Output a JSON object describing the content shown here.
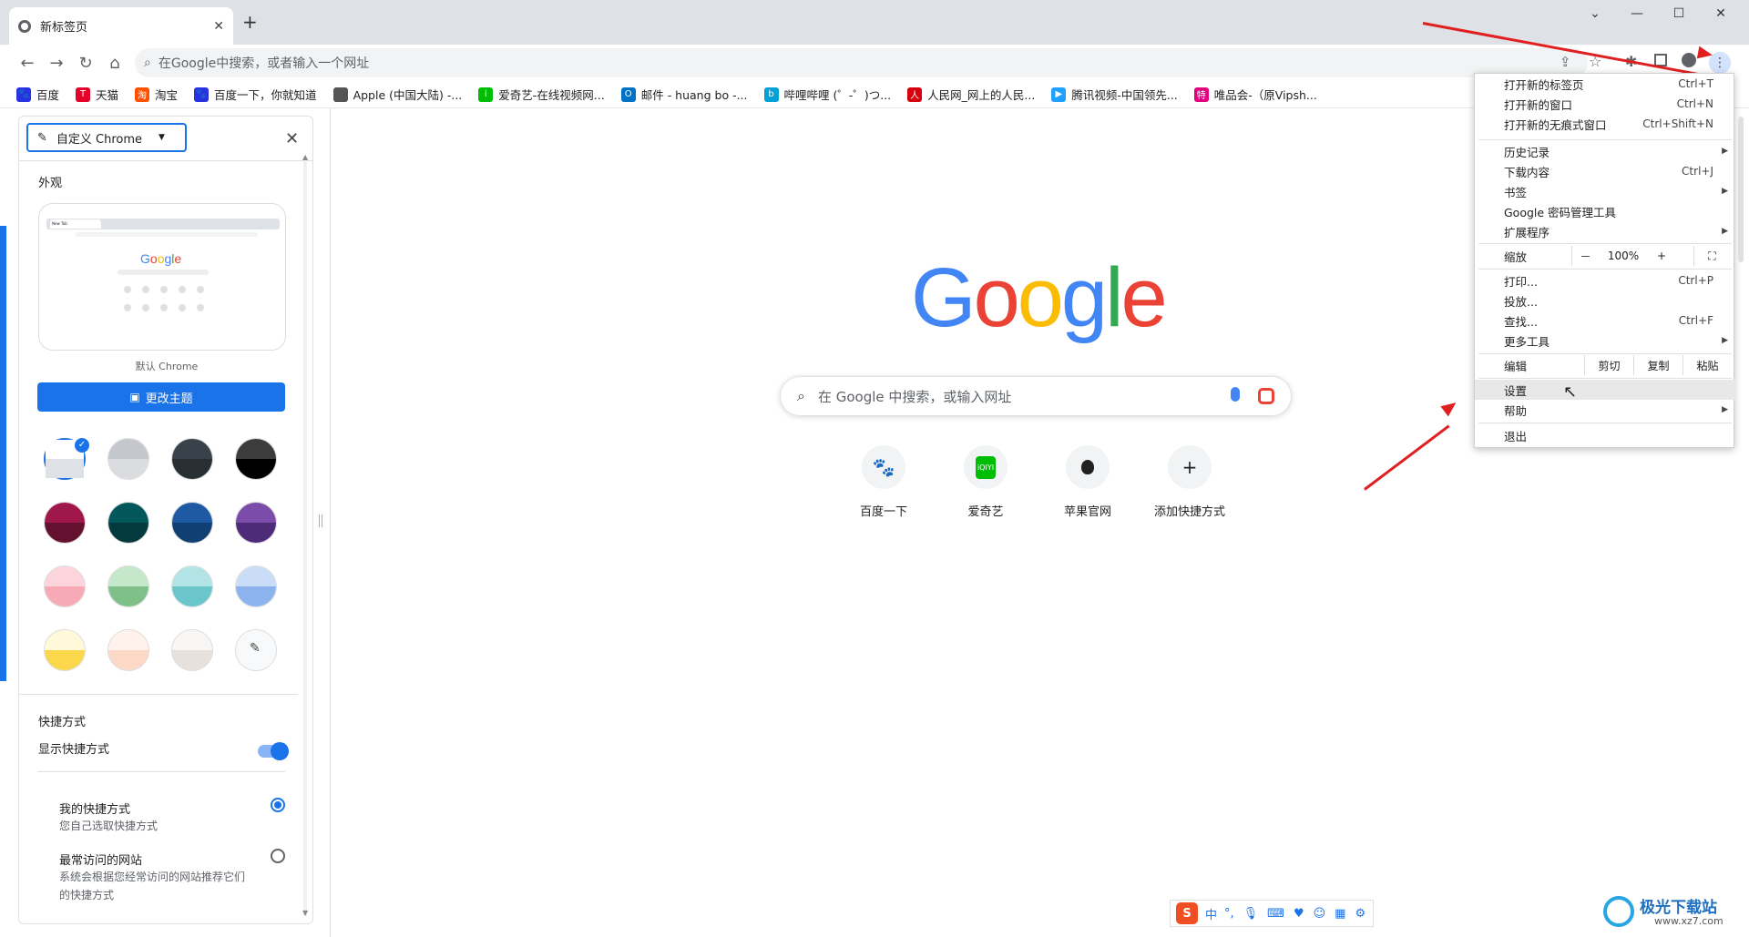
{
  "browser": {
    "tab_title": "新标签页",
    "new_tab_symbol": "+",
    "omnibox_placeholder": "在Google中搜索，或者输入一个网址",
    "window_controls": [
      "chevron-down-icon",
      "minimize-icon",
      "maximize-icon",
      "close-icon"
    ]
  },
  "bookmarks": [
    {
      "label": "百度",
      "color": "#2932e1",
      "icon": "paw-icon"
    },
    {
      "label": "天猫",
      "color": "#e4002b",
      "icon": "tmall-icon"
    },
    {
      "label": "淘宝",
      "color": "#ff5000",
      "icon": "taobao-icon"
    },
    {
      "label": "百度一下，你就知道",
      "color": "#2932e1",
      "icon": "paw-icon"
    },
    {
      "label": "Apple (中国大陆) -...",
      "color": "#555555",
      "icon": "apple-icon"
    },
    {
      "label": "爱奇艺-在线视频网...",
      "color": "#00be06",
      "icon": "iqiyi-icon"
    },
    {
      "label": "邮件 - huang bo -...",
      "color": "#0072c6",
      "icon": "outlook-icon"
    },
    {
      "label": "哔哩哔哩 (゜-゜)つ...",
      "color": "#00a1d6",
      "icon": "bilibili-icon"
    },
    {
      "label": "人民网_网上的人民...",
      "color": "#d7000f",
      "icon": "people-icon"
    },
    {
      "label": "腾讯视频-中国领先...",
      "color": "#20a0ff",
      "icon": "tencent-video-icon"
    },
    {
      "label": "唯品会-（原Vipsh...",
      "color": "#e4007f",
      "icon": "vip-icon"
    }
  ],
  "panel": {
    "dropdown_label": "自定义 Chrome",
    "appearance_title": "外观",
    "preview_caption": "默认 Chrome",
    "preview_tab": "New Tab",
    "preview_logo": "Google",
    "change_theme_button": "更改主题",
    "swatches": [
      [
        "#ffffff",
        "#dee1e6"
      ],
      [
        "#c4c7cc",
        "#dadce0"
      ],
      [
        "#39424b",
        "#283033"
      ],
      [
        "#3c3c3c",
        "#000000"
      ],
      [
        "#a0174b",
        "#63112e"
      ],
      [
        "#02575b",
        "#043a3d"
      ],
      [
        "#1e5aa4",
        "#0f3f73"
      ],
      [
        "#7c4cab",
        "#4d2b78"
      ],
      [
        "#fcd5dc",
        "#f8a9b6"
      ],
      [
        "#c5e8ca",
        "#7ec088"
      ],
      [
        "#b2e4e5",
        "#6ac6ca"
      ],
      [
        "#c9dcf8",
        "#8cb3ed"
      ],
      [
        "#fff8d9",
        "#fbd74c"
      ],
      [
        "#fff2ec",
        "#fcd8c6"
      ],
      [
        "#f8f6f4",
        "#e7e1dd"
      ],
      [
        "#f8f9fa",
        "#f8f9fa"
      ]
    ],
    "shortcuts_title": "快捷方式",
    "show_shortcuts_label": "显示快捷方式",
    "show_shortcuts_on": true,
    "my_shortcuts_title": "我的快捷方式",
    "my_shortcuts_desc": "您自己选取快捷方式",
    "most_visited_title": "最常访问的网站",
    "most_visited_desc_line1": "系统会根据您经常访问的网站推荐它们",
    "most_visited_desc_line2": "的快捷方式"
  },
  "ntp": {
    "logo": "Google",
    "search_placeholder": "在 Google 中搜索，或输入网址",
    "shortcuts": [
      {
        "label": "百度一下",
        "icon": "baidu-icon"
      },
      {
        "label": "爱奇艺",
        "icon": "iqiyi-icon"
      },
      {
        "label": "苹果官网",
        "icon": "apple-icon"
      },
      {
        "label": "添加快捷方式",
        "icon": "plus-icon"
      }
    ]
  },
  "menu": {
    "new_tab": "打开新的标签页",
    "new_tab_sc": "Ctrl+T",
    "new_window": "打开新的窗口",
    "new_window_sc": "Ctrl+N",
    "incognito": "打开新的无痕式窗口",
    "incognito_sc": "Ctrl+Shift+N",
    "history": "历史记录",
    "downloads": "下载内容",
    "downloads_sc": "Ctrl+J",
    "bookmarks": "书签",
    "passwords": "Google 密码管理工具",
    "extensions": "扩展程序",
    "zoom": "缩放",
    "zoom_minus": "－",
    "zoom_value": "100%",
    "zoom_plus": "+",
    "print": "打印...",
    "print_sc": "Ctrl+P",
    "cast": "投放...",
    "find": "查找...",
    "find_sc": "Ctrl+F",
    "more_tools": "更多工具",
    "edit": "编辑",
    "cut": "剪切",
    "copy": "复制",
    "paste": "粘贴",
    "settings": "设置",
    "help": "帮助",
    "exit": "退出"
  },
  "ime": {
    "label": "中"
  },
  "watermark": {
    "title": "极光下载站",
    "url": "www.xz7.com"
  },
  "colors": {
    "accent": "#1a73e8",
    "arrow": "#e02020"
  }
}
